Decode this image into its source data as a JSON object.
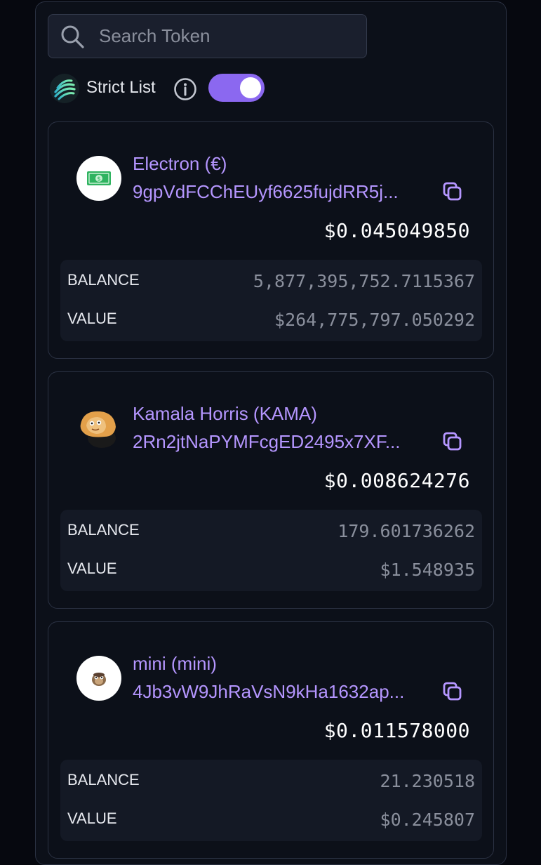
{
  "search": {
    "placeholder": "Search Token",
    "icon": "search-icon"
  },
  "strict_list": {
    "label": "Strict List",
    "enabled": true,
    "toggle_color": "#8b68f0"
  },
  "accent_color": "#b596ff",
  "tokens": [
    {
      "name": "Electron (€)",
      "address": "9gpVdFCChEUyf6625fujdRR5j...",
      "price": "$0.045049850",
      "balance_label": "BALANCE",
      "balance": "5,877,395,752.7115367",
      "value_label": "VALUE",
      "value": "$264,775,797.050292",
      "icon": "money-bill-icon"
    },
    {
      "name": "Kamala Horris (KAMA)",
      "address": "2Rn2jtNaPYMFcgED2495x7XF...",
      "price": "$0.008624276",
      "balance_label": "BALANCE",
      "balance": "179.601736262",
      "value_label": "VALUE",
      "value": "$1.548935",
      "icon": "cartoon-avatar-icon"
    },
    {
      "name": "mini (mini)",
      "address": "4Jb3vW9JhRaVsN9kHa1632ap...",
      "price": "$0.011578000",
      "balance_label": "BALANCE",
      "balance": "21.230518",
      "value_label": "VALUE",
      "value": "$0.245807",
      "icon": "mini-creature-icon"
    }
  ]
}
